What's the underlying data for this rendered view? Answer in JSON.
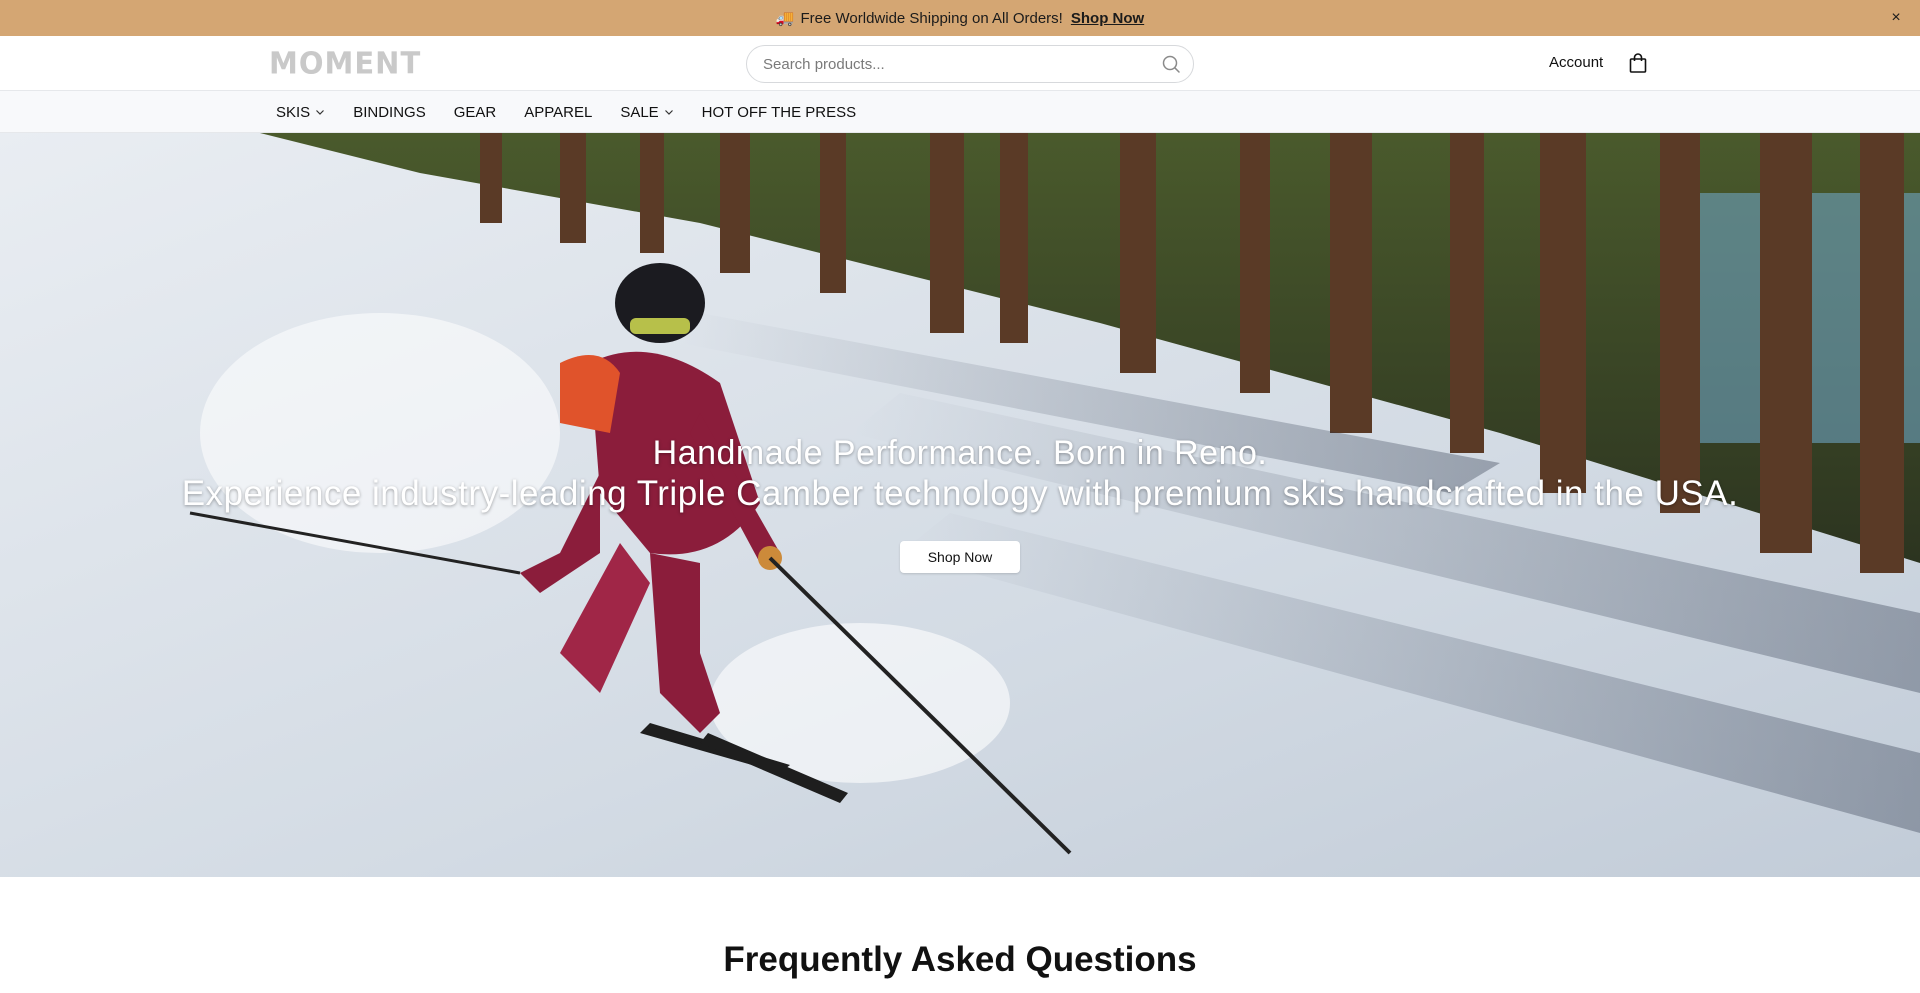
{
  "announcement": {
    "text": "Free Worldwide Shipping on All Orders!",
    "link": "Shop Now",
    "close": "×",
    "truck": "🚚"
  },
  "header": {
    "logo": "MOMENT",
    "search_placeholder": "Search products...",
    "account": "Account"
  },
  "nav": {
    "items": [
      {
        "label": "SKIS",
        "dropdown": true
      },
      {
        "label": "BINDINGS",
        "dropdown": false
      },
      {
        "label": "GEAR",
        "dropdown": false
      },
      {
        "label": "APPAREL",
        "dropdown": false
      },
      {
        "label": "SALE",
        "dropdown": true
      },
      {
        "label": "HOT OFF THE PRESS",
        "dropdown": false
      }
    ]
  },
  "hero": {
    "headline": "Handmade Performance. Born in Reno.",
    "subline": "Experience industry-leading Triple Camber technology with premium skis handcrafted in the USA.",
    "cta": "Shop Now"
  },
  "faq": {
    "title": "Frequently Asked Questions"
  },
  "colors": {
    "announcement_bg": "#d4a673",
    "nav_bg": "#f8f9fb"
  }
}
